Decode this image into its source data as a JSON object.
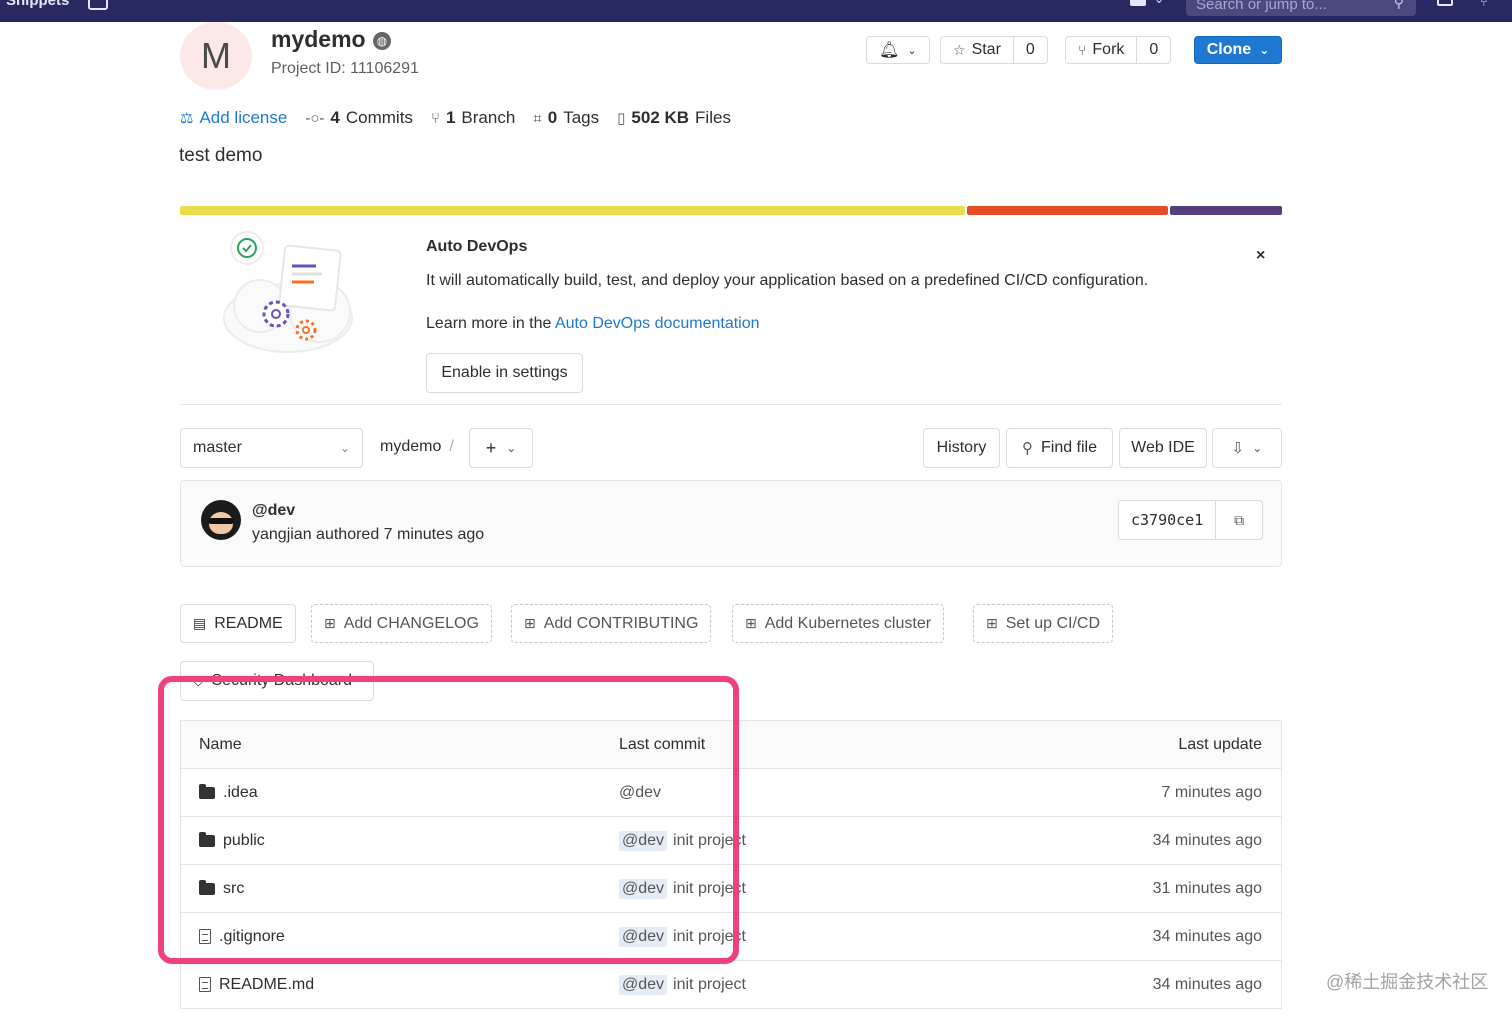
{
  "topnav": {
    "snippets_label": "Snippets",
    "search_placeholder": "Search or jump to..."
  },
  "project": {
    "avatar_letter": "M",
    "name": "mydemo",
    "id_text": "Project ID: 11106291",
    "description": "test demo"
  },
  "header_buttons": {
    "star_label": "Star",
    "star_count": "0",
    "fork_label": "Fork",
    "fork_count": "0",
    "clone_label": "Clone"
  },
  "stats": {
    "license_label": "Add license",
    "commits_count": "4",
    "commits_label": "Commits",
    "branch_count": "1",
    "branch_label": "Branch",
    "tags_count": "0",
    "tags_label": "Tags",
    "files_size": "502 KB",
    "files_label": "Files"
  },
  "language_bar": [
    {
      "color": "#ebdc4c",
      "fraction": 0.715
    },
    {
      "color": "#e44d26",
      "fraction": 0.183
    },
    {
      "color": "#563d7c",
      "fraction": 0.102
    }
  ],
  "auto_devops": {
    "title": "Auto DevOps",
    "text": "It will automatically build, test, and deploy your application based on a predefined CI/CD configuration.",
    "learn_prefix": "Learn more in the",
    "learn_link": "Auto DevOps documentation",
    "button": "Enable in settings",
    "close": "×"
  },
  "tree": {
    "branch": "master",
    "path": "mydemo",
    "separator": "/",
    "add_symbol": "+",
    "history": "History",
    "find_file": "Find file",
    "web_ide": "Web IDE"
  },
  "commit": {
    "title": "@dev",
    "meta": "yangjian authored 7 minutes ago",
    "sha": "c3790ce1"
  },
  "quick_actions": {
    "readme": "README",
    "changelog": "Add CHANGELOG",
    "contributing": "Add CONTRIBUTING",
    "kubernetes": "Add Kubernetes cluster",
    "cicd": "Set up CI/CD",
    "security": "Security Dashboard"
  },
  "file_table": {
    "headers": {
      "name": "Name",
      "last_commit": "Last commit",
      "last_update": "Last update"
    },
    "rows": [
      {
        "name": ".idea",
        "type": "folder",
        "commit_tag": "@dev",
        "commit_msg": "",
        "updated": "7 minutes ago"
      },
      {
        "name": "public",
        "type": "folder",
        "commit_tag": "@dev",
        "commit_msg": "init project",
        "updated": "34 minutes ago"
      },
      {
        "name": "src",
        "type": "folder",
        "commit_tag": "@dev",
        "commit_msg": "init project",
        "updated": "31 minutes ago"
      },
      {
        "name": ".gitignore",
        "type": "file",
        "commit_tag": "@dev",
        "commit_msg": "init project",
        "updated": "34 minutes ago"
      },
      {
        "name": "README.md",
        "type": "file",
        "commit_tag": "@dev",
        "commit_msg": "init project",
        "updated": "34 minutes ago"
      }
    ]
  },
  "watermark": "@稀土掘金技术社区",
  "colors": {
    "nav_bg": "#292961",
    "accent_blue": "#1f78d1",
    "highlight_pink": "#f0417a"
  }
}
